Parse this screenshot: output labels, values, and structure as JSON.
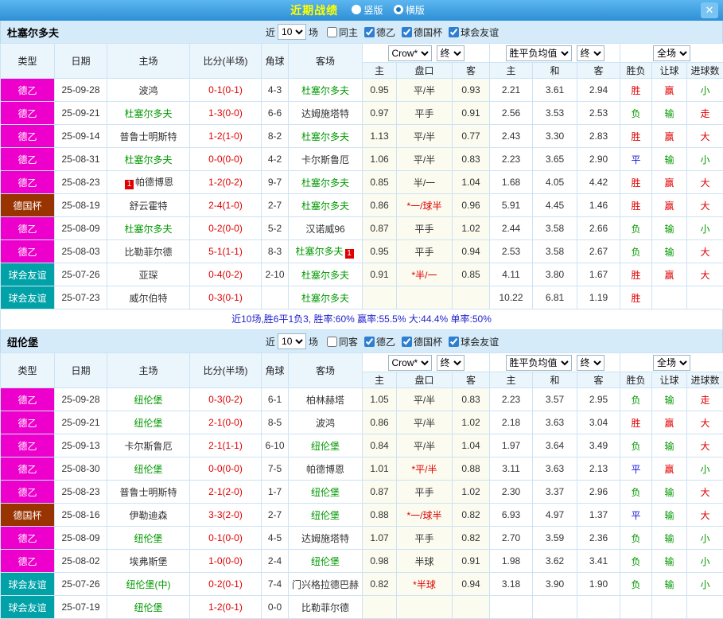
{
  "topbar": {
    "title": "近期战绩",
    "vertical_label": "竖版",
    "horizontal_label": "横版",
    "selected_layout": "横版",
    "close_glyph": "✕"
  },
  "filters": {
    "near_label": "近",
    "count": "10",
    "games_label": "场",
    "leagues": [
      "德乙",
      "德国杯",
      "球会友谊"
    ],
    "bookmaker": "Crow*",
    "final_label": "终",
    "euro_avg": "胜平负均值",
    "scope": "全场"
  },
  "table_headers": {
    "type": "类型",
    "date": "日期",
    "home": "主场",
    "score": "比分(半场)",
    "corner": "角球",
    "away": "客场",
    "sub": [
      "主",
      "盘口",
      "客",
      "主",
      "和",
      "客",
      "胜负",
      "让球",
      "进球数"
    ]
  },
  "colors": {
    "title_yellow": "#ffff00",
    "bar_blue": "#2e8fd6",
    "league_de2": "#ee00cc",
    "league_cup": "#993300",
    "league_friendly": "#00a2a8",
    "win_red": "#e00000",
    "lose_green": "#009900",
    "draw_blue": "#1414dd",
    "focus_team_green": "#009900"
  },
  "sections": [
    {
      "team": "杜塞尔多夫",
      "same_label": "同主",
      "summary": "近10场,胜6平1负3, 胜率:60% 赢率:55.5% 大:44.4% 单率:50%",
      "rows": [
        {
          "lg": "德乙",
          "lc": "l-de2",
          "dt": "25-09-28",
          "hm": "波鸿",
          "hf": false,
          "hb1": "",
          "hb2": "",
          "sc": "0-1(0-1)",
          "cn": "4-3",
          "aw": "杜塞尔多夫",
          "af": true,
          "ab1": "",
          "ab2": "",
          "ah": "0.95",
          "hd": "平/半",
          "hdr": false,
          "aa": "0.93",
          "eh": "2.21",
          "ed": "3.61",
          "ea": "2.94",
          "rs": "胜",
          "rsc": "r",
          "lt": "赢",
          "ltc": "r",
          "ou": "小",
          "ouc": "g"
        },
        {
          "lg": "德乙",
          "lc": "l-de2",
          "dt": "25-09-21",
          "hm": "杜塞尔多夫",
          "hf": true,
          "hb1": "",
          "hb2": "",
          "sc": "1-3(0-0)",
          "cn": "6-6",
          "aw": "达姆施塔特",
          "af": false,
          "ab1": "",
          "ab2": "",
          "ah": "0.97",
          "hd": "平手",
          "hdr": false,
          "aa": "0.91",
          "eh": "2.56",
          "ed": "3.53",
          "ea": "2.53",
          "rs": "负",
          "rsc": "g",
          "lt": "输",
          "ltc": "g",
          "ou": "走",
          "ouc": "r"
        },
        {
          "lg": "德乙",
          "lc": "l-de2",
          "dt": "25-09-14",
          "hm": "普鲁士明斯特",
          "hf": false,
          "hb1": "",
          "hb2": "",
          "sc": "1-2(1-0)",
          "cn": "8-2",
          "aw": "杜塞尔多夫",
          "af": true,
          "ab1": "",
          "ab2": "",
          "ah": "1.13",
          "hd": "平/半",
          "hdr": false,
          "aa": "0.77",
          "eh": "2.43",
          "ed": "3.30",
          "ea": "2.83",
          "rs": "胜",
          "rsc": "r",
          "lt": "赢",
          "ltc": "r",
          "ou": "大",
          "ouc": "r"
        },
        {
          "lg": "德乙",
          "lc": "l-de2",
          "dt": "25-08-31",
          "hm": "杜塞尔多夫",
          "hf": true,
          "hb1": "",
          "hb2": "",
          "sc": "0-0(0-0)",
          "cn": "4-2",
          "aw": "卡尔斯鲁厄",
          "af": false,
          "ab1": "",
          "ab2": "",
          "ah": "1.06",
          "hd": "平/半",
          "hdr": false,
          "aa": "0.83",
          "eh": "2.23",
          "ed": "3.65",
          "ea": "2.90",
          "rs": "平",
          "rsc": "b",
          "lt": "输",
          "ltc": "g",
          "ou": "小",
          "ouc": "g"
        },
        {
          "lg": "德乙",
          "lc": "l-de2",
          "dt": "25-08-23",
          "hm": "帕德博恩",
          "hf": false,
          "hb1": "1",
          "hb2": "",
          "sc": "1-2(0-2)",
          "cn": "9-7",
          "aw": "杜塞尔多夫",
          "af": true,
          "ab1": "",
          "ab2": "",
          "ah": "0.85",
          "hd": "半/一",
          "hdr": false,
          "aa": "1.04",
          "eh": "1.68",
          "ed": "4.05",
          "ea": "4.42",
          "rs": "胜",
          "rsc": "r",
          "lt": "赢",
          "ltc": "r",
          "ou": "大",
          "ouc": "r"
        },
        {
          "lg": "德国杯",
          "lc": "l-cup",
          "dt": "25-08-19",
          "hm": "舒云霍特",
          "hf": false,
          "hb1": "",
          "hb2": "",
          "sc": "2-4(1-0)",
          "cn": "2-7",
          "aw": "杜塞尔多夫",
          "af": true,
          "ab1": "",
          "ab2": "",
          "ah": "0.86",
          "hd": "*一/球半",
          "hdr": true,
          "aa": "0.96",
          "eh": "5.91",
          "ed": "4.45",
          "ea": "1.46",
          "rs": "胜",
          "rsc": "r",
          "lt": "赢",
          "ltc": "r",
          "ou": "大",
          "ouc": "r"
        },
        {
          "lg": "德乙",
          "lc": "l-de2",
          "dt": "25-08-09",
          "hm": "杜塞尔多夫",
          "hf": true,
          "hb1": "",
          "hb2": "",
          "sc": "0-2(0-0)",
          "cn": "5-2",
          "aw": "汉诺威96",
          "af": false,
          "ab1": "",
          "ab2": "",
          "ah": "0.87",
          "hd": "平手",
          "hdr": false,
          "aa": "1.02",
          "eh": "2.44",
          "ed": "3.58",
          "ea": "2.66",
          "rs": "负",
          "rsc": "g",
          "lt": "输",
          "ltc": "g",
          "ou": "小",
          "ouc": "g"
        },
        {
          "lg": "德乙",
          "lc": "l-de2",
          "dt": "25-08-03",
          "hm": "比勒菲尔德",
          "hf": false,
          "hb1": "",
          "hb2": "",
          "sc": "5-1(1-1)",
          "cn": "8-3",
          "aw": "杜塞尔多夫",
          "af": true,
          "ab1": "",
          "ab2": "1",
          "ah": "0.95",
          "hd": "平手",
          "hdr": false,
          "aa": "0.94",
          "eh": "2.53",
          "ed": "3.58",
          "ea": "2.67",
          "rs": "负",
          "rsc": "g",
          "lt": "输",
          "ltc": "g",
          "ou": "大",
          "ouc": "r"
        },
        {
          "lg": "球会友谊",
          "lc": "l-fr",
          "dt": "25-07-26",
          "hm": "亚琛",
          "hf": false,
          "hb1": "",
          "hb2": "",
          "sc": "0-4(0-2)",
          "cn": "2-10",
          "aw": "杜塞尔多夫",
          "af": true,
          "ab1": "",
          "ab2": "",
          "ah": "0.91",
          "hd": "*半/一",
          "hdr": true,
          "aa": "0.85",
          "eh": "4.11",
          "ed": "3.80",
          "ea": "1.67",
          "rs": "胜",
          "rsc": "r",
          "lt": "赢",
          "ltc": "r",
          "ou": "大",
          "ouc": "r"
        },
        {
          "lg": "球会友谊",
          "lc": "l-fr",
          "dt": "25-07-23",
          "hm": "威尔伯特",
          "hf": false,
          "hb1": "",
          "hb2": "",
          "sc": "0-3(0-1)",
          "cn": "",
          "aw": "杜塞尔多夫",
          "af": true,
          "ab1": "",
          "ab2": "",
          "ah": "",
          "hd": "",
          "hdr": false,
          "aa": "",
          "eh": "10.22",
          "ed": "6.81",
          "ea": "1.19",
          "rs": "胜",
          "rsc": "r",
          "lt": "",
          "ltc": "",
          "ou": "",
          "ouc": ""
        }
      ]
    },
    {
      "team": "纽伦堡",
      "same_label": "同客",
      "summary": "",
      "rows": [
        {
          "lg": "德乙",
          "lc": "l-de2",
          "dt": "25-09-28",
          "hm": "纽伦堡",
          "hf": true,
          "hb1": "",
          "hb2": "",
          "sc": "0-3(0-2)",
          "cn": "6-1",
          "aw": "柏林赫塔",
          "af": false,
          "ab1": "",
          "ab2": "",
          "ah": "1.05",
          "hd": "平/半",
          "hdr": false,
          "aa": "0.83",
          "eh": "2.23",
          "ed": "3.57",
          "ea": "2.95",
          "rs": "负",
          "rsc": "g",
          "lt": "输",
          "ltc": "g",
          "ou": "走",
          "ouc": "r"
        },
        {
          "lg": "德乙",
          "lc": "l-de2",
          "dt": "25-09-21",
          "hm": "纽伦堡",
          "hf": true,
          "hb1": "",
          "hb2": "",
          "sc": "2-1(0-0)",
          "cn": "8-5",
          "aw": "波鸿",
          "af": false,
          "ab1": "",
          "ab2": "",
          "ah": "0.86",
          "hd": "平/半",
          "hdr": false,
          "aa": "1.02",
          "eh": "2.18",
          "ed": "3.63",
          "ea": "3.04",
          "rs": "胜",
          "rsc": "r",
          "lt": "赢",
          "ltc": "r",
          "ou": "大",
          "ouc": "r"
        },
        {
          "lg": "德乙",
          "lc": "l-de2",
          "dt": "25-09-13",
          "hm": "卡尔斯鲁厄",
          "hf": false,
          "hb1": "",
          "hb2": "",
          "sc": "2-1(1-1)",
          "cn": "6-10",
          "aw": "纽伦堡",
          "af": true,
          "ab1": "",
          "ab2": "",
          "ah": "0.84",
          "hd": "平/半",
          "hdr": false,
          "aa": "1.04",
          "eh": "1.97",
          "ed": "3.64",
          "ea": "3.49",
          "rs": "负",
          "rsc": "g",
          "lt": "输",
          "ltc": "g",
          "ou": "大",
          "ouc": "r"
        },
        {
          "lg": "德乙",
          "lc": "l-de2",
          "dt": "25-08-30",
          "hm": "纽伦堡",
          "hf": true,
          "hb1": "",
          "hb2": "",
          "sc": "0-0(0-0)",
          "cn": "7-5",
          "aw": "帕德博恩",
          "af": false,
          "ab1": "",
          "ab2": "",
          "ah": "1.01",
          "hd": "*平/半",
          "hdr": true,
          "aa": "0.88",
          "eh": "3.11",
          "ed": "3.63",
          "ea": "2.13",
          "rs": "平",
          "rsc": "b",
          "lt": "赢",
          "ltc": "r",
          "ou": "小",
          "ouc": "g"
        },
        {
          "lg": "德乙",
          "lc": "l-de2",
          "dt": "25-08-23",
          "hm": "普鲁士明斯特",
          "hf": false,
          "hb1": "",
          "hb2": "",
          "sc": "2-1(2-0)",
          "cn": "1-7",
          "aw": "纽伦堡",
          "af": true,
          "ab1": "",
          "ab2": "",
          "ah": "0.87",
          "hd": "平手",
          "hdr": false,
          "aa": "1.02",
          "eh": "2.30",
          "ed": "3.37",
          "ea": "2.96",
          "rs": "负",
          "rsc": "g",
          "lt": "输",
          "ltc": "g",
          "ou": "大",
          "ouc": "r"
        },
        {
          "lg": "德国杯",
          "lc": "l-cup",
          "dt": "25-08-16",
          "hm": "伊勒迪森",
          "hf": false,
          "hb1": "",
          "hb2": "",
          "sc": "3-3(2-0)",
          "cn": "2-7",
          "aw": "纽伦堡",
          "af": true,
          "ab1": "",
          "ab2": "",
          "ah": "0.88",
          "hd": "*一/球半",
          "hdr": true,
          "aa": "0.82",
          "eh": "6.93",
          "ed": "4.97",
          "ea": "1.37",
          "rs": "平",
          "rsc": "b",
          "lt": "输",
          "ltc": "g",
          "ou": "大",
          "ouc": "r"
        },
        {
          "lg": "德乙",
          "lc": "l-de2",
          "dt": "25-08-09",
          "hm": "纽伦堡",
          "hf": true,
          "hb1": "",
          "hb2": "",
          "sc": "0-1(0-0)",
          "cn": "4-5",
          "aw": "达姆施塔特",
          "af": false,
          "ab1": "",
          "ab2": "",
          "ah": "1.07",
          "hd": "平手",
          "hdr": false,
          "aa": "0.82",
          "eh": "2.70",
          "ed": "3.59",
          "ea": "2.36",
          "rs": "负",
          "rsc": "g",
          "lt": "输",
          "ltc": "g",
          "ou": "小",
          "ouc": "g"
        },
        {
          "lg": "德乙",
          "lc": "l-de2",
          "dt": "25-08-02",
          "hm": "埃弗斯堡",
          "hf": false,
          "hb1": "",
          "hb2": "",
          "sc": "1-0(0-0)",
          "cn": "2-4",
          "aw": "纽伦堡",
          "af": true,
          "ab1": "",
          "ab2": "",
          "ah": "0.98",
          "hd": "半球",
          "hdr": false,
          "aa": "0.91",
          "eh": "1.98",
          "ed": "3.62",
          "ea": "3.41",
          "rs": "负",
          "rsc": "g",
          "lt": "输",
          "ltc": "g",
          "ou": "小",
          "ouc": "g"
        },
        {
          "lg": "球会友谊",
          "lc": "l-fr",
          "dt": "25-07-26",
          "hm": "纽伦堡(中)",
          "hf": true,
          "hb1": "",
          "hb2": "",
          "sc": "0-2(0-1)",
          "cn": "7-4",
          "aw": "门兴格拉德巴赫",
          "af": false,
          "ab1": "",
          "ab2": "",
          "ah": "0.82",
          "hd": "*半球",
          "hdr": true,
          "aa": "0.94",
          "eh": "3.18",
          "ed": "3.90",
          "ea": "1.90",
          "rs": "负",
          "rsc": "g",
          "lt": "输",
          "ltc": "g",
          "ou": "小",
          "ouc": "g"
        },
        {
          "lg": "球会友谊",
          "lc": "l-fr",
          "dt": "25-07-19",
          "hm": "纽伦堡",
          "hf": true,
          "hb1": "",
          "hb2": "",
          "sc": "1-2(0-1)",
          "cn": "0-0",
          "aw": "比勒菲尔德",
          "af": false,
          "ab1": "",
          "ab2": "",
          "ah": "",
          "hd": "",
          "hdr": false,
          "aa": "",
          "eh": "",
          "ed": "",
          "ea": "",
          "rs": "",
          "rsc": "",
          "lt": "",
          "ltc": "",
          "ou": "",
          "ouc": ""
        }
      ]
    }
  ]
}
